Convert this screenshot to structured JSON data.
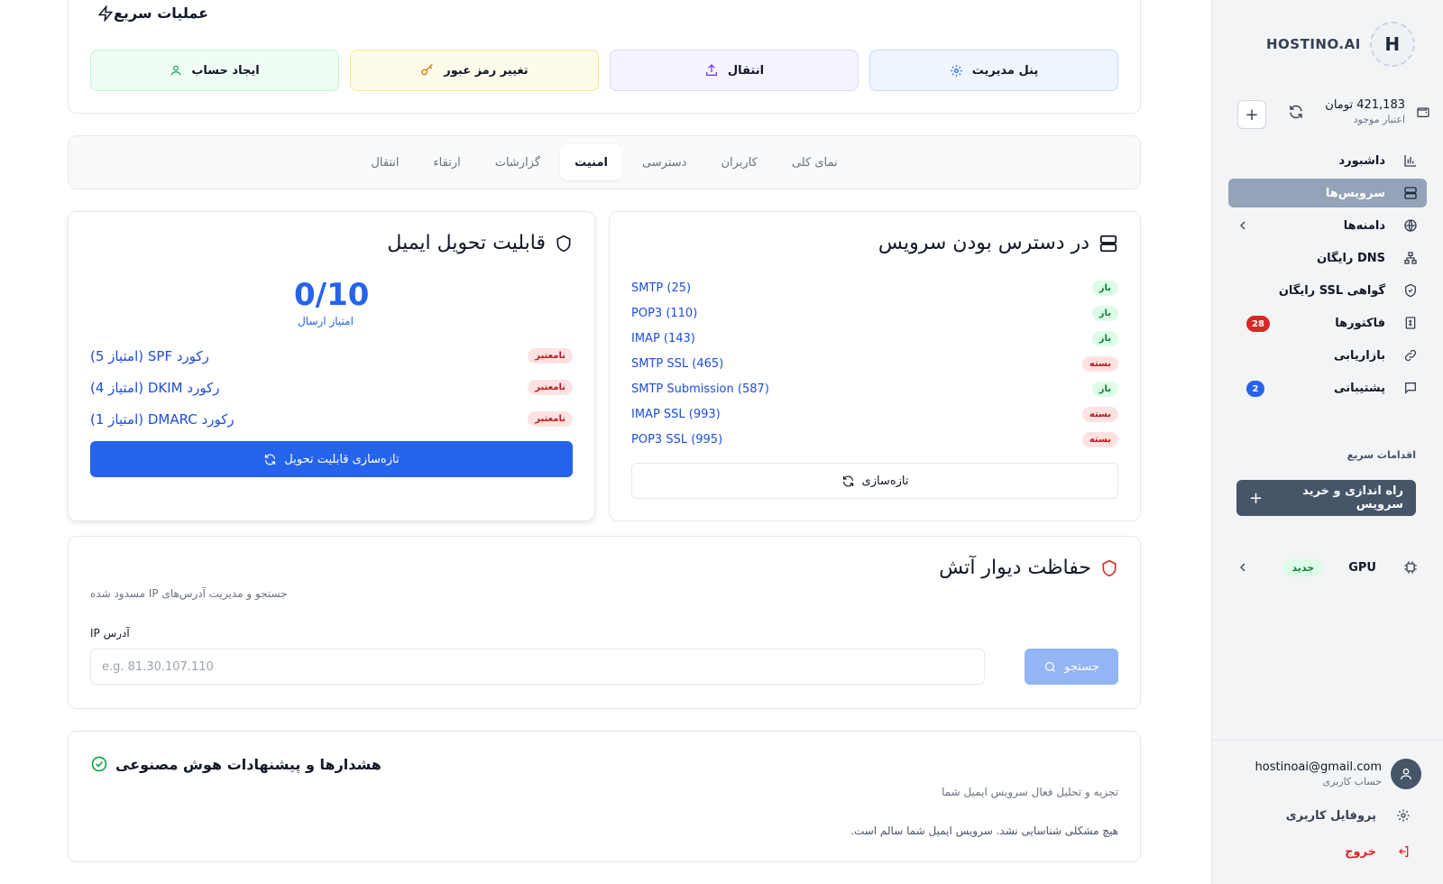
{
  "sidebar": {
    "logo_text": "HOSTINO.AI",
    "logo_mark": "H",
    "balance_amount": "421,183 تومان",
    "balance_label": "اعتبار موجود",
    "nav": [
      {
        "label": "داشبورد",
        "icon": "chart-bar-icon"
      },
      {
        "label": "سرویس‌ها",
        "icon": "server-icon",
        "active": true
      },
      {
        "label": "دامنه‌ها",
        "icon": "globe-icon",
        "has_submenu": true
      },
      {
        "label": "DNS رایگان",
        "icon": "network-icon"
      },
      {
        "label": "گواهی SSL رایگان",
        "icon": "shield-check-icon"
      },
      {
        "label": "فاکتورها",
        "icon": "receipt-icon",
        "badge": "28",
        "badge_color": "#dc2626"
      },
      {
        "label": "بازاریابی",
        "icon": "link-icon"
      },
      {
        "label": "پشتیبانی",
        "icon": "message-icon",
        "badge": "2",
        "badge_color": "#2563eb"
      }
    ],
    "quick_actions_title": "اقدامات سریع",
    "quick_actions_button": "راه اندازی و خرید سرویس",
    "gpu_label": "GPU",
    "gpu_badge": "جدید",
    "user_email": "hostinoai@gmail.com",
    "user_role": "حساب کاربری",
    "profile_label": "پروفایل کاربری",
    "logout_label": "خروج"
  },
  "quick_ops": {
    "title": "عملیات سریع",
    "buttons": [
      {
        "label": "ایجاد حساب",
        "icon": "user-icon",
        "color": "#16a34a"
      },
      {
        "label": "تغییر رمز عبور",
        "icon": "key-icon",
        "color": "#d97706"
      },
      {
        "label": "انتقال",
        "icon": "upload-icon",
        "color": "#7c3aed"
      },
      {
        "label": "پنل مدیریت",
        "icon": "gear-icon",
        "color": "#2563eb"
      }
    ]
  },
  "tabs": [
    "نمای کلی",
    "کاربران",
    "دسترسی",
    "امنیت",
    "گزارشات",
    "ارتقاء",
    "انتقال"
  ],
  "active_tab": "امنیت",
  "service_availability": {
    "title": "در دسترس بودن سرویس",
    "ports": [
      {
        "name": "SMTP (25)",
        "status": "باز",
        "open": true
      },
      {
        "name": "POP3 (110)",
        "status": "باز",
        "open": true
      },
      {
        "name": "IMAP (143)",
        "status": "باز",
        "open": true
      },
      {
        "name": "SMTP SSL (465)",
        "status": "بسته",
        "open": false
      },
      {
        "name": "SMTP Submission (587)",
        "status": "باز",
        "open": true
      },
      {
        "name": "IMAP SSL (993)",
        "status": "بسته",
        "open": false
      },
      {
        "name": "POP3 SSL (995)",
        "status": "بسته",
        "open": false
      }
    ],
    "refresh_label": "تازه‌سازی"
  },
  "deliverability": {
    "title": "قابلیت تحویل ایمیل",
    "score": "0/10",
    "score_label": "امتیاز ارسال",
    "records": [
      {
        "name": "رکورد SPF (امتیاز 5)",
        "status": "نامعتبر"
      },
      {
        "name": "رکورد DKIM (امتیاز 4)",
        "status": "نامعتبر"
      },
      {
        "name": "رکورد DMARC (امتیاز 1)",
        "status": "نامعتبر"
      }
    ],
    "refresh_label": "تازه‌سازی قابلیت تحویل"
  },
  "firewall": {
    "title": "حفاظت دیوار آتش",
    "subtitle": "جستجو و مدیریت آدرس‌های IP مسدود شده",
    "ip_label": "آدرس IP",
    "ip_placeholder": "e.g. 81.30.107.110",
    "search_label": "جستجو"
  },
  "ai_alerts": {
    "title": "هشدارها و پیشنهادات هوش مصنوعی",
    "subtitle": "تجزیه و تحلیل فعال سرویس ایمیل شما",
    "message": "هیچ مشکلی شناسایی نشد. سرویس ایمیل شما سالم است."
  }
}
